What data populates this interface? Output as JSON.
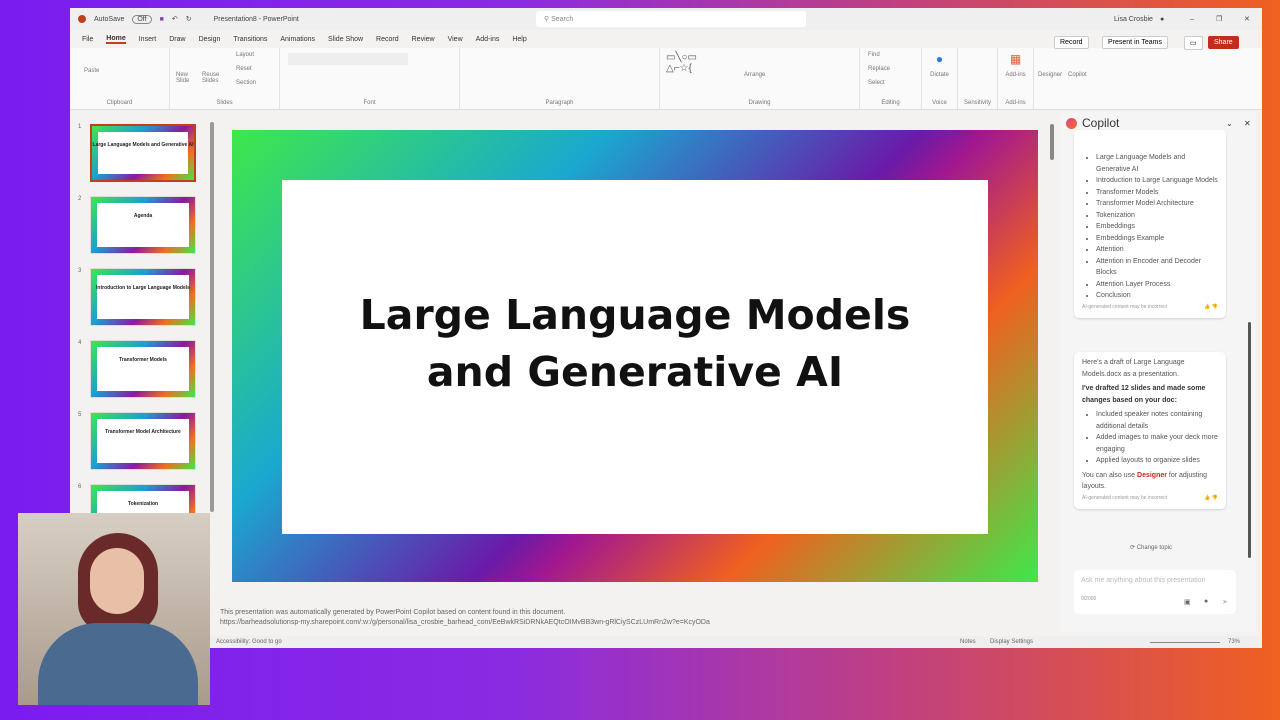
{
  "titlebar": {
    "autosave": "AutoSave",
    "autosave_state": "Off",
    "doc_title": "Presentation8 - PowerPoint",
    "search_placeholder": "Search",
    "user": "Lisa Crosbie"
  },
  "tabs": [
    "File",
    "Home",
    "Insert",
    "Draw",
    "Design",
    "Transitions",
    "Animations",
    "Slide Show",
    "Record",
    "Review",
    "View",
    "Add-ins",
    "Help"
  ],
  "actions": {
    "record": "Record",
    "present": "Present in Teams",
    "share": "Share"
  },
  "ribbon_groups": [
    "Clipboard",
    "Slides",
    "Font",
    "Paragraph",
    "Drawing",
    "Editing",
    "Voice",
    "Sensitivity",
    "Add-ins"
  ],
  "ribbon_buttons": {
    "paste": "Paste",
    "new_slide": "New Slide",
    "reuse": "Reuse Slides",
    "layout": "Layout",
    "reset": "Reset",
    "section": "Section",
    "arrange": "Arrange",
    "find": "Find",
    "replace": "Replace",
    "select": "Select",
    "dictate": "Dictate",
    "addins": "Add-ins",
    "designer": "Designer",
    "copilot": "Copilot"
  },
  "thumbnails": [
    {
      "num": "1",
      "title": "Large Language Models and Generative AI"
    },
    {
      "num": "2",
      "title": "Agenda"
    },
    {
      "num": "3",
      "title": "Introduction to Large Language Models"
    },
    {
      "num": "4",
      "title": "Transformer Models"
    },
    {
      "num": "5",
      "title": "Transformer Model Architecture"
    },
    {
      "num": "6",
      "title": "Tokenization"
    }
  ],
  "slide": {
    "title_line1": "Large Language Models",
    "title_line2": "and Generative AI"
  },
  "notes": {
    "line1": "This presentation was automatically generated by PowerPoint Copilot based on content found in this document.",
    "line2": "https://barheadsolutionsp-my.sharepoint.com/:w:/g/personal/lisa_crosbie_barhead_com/EeBwkRSiDRNkAEQtcOIMvBB3wn-gRlCiySCzLUmRn2w?e=KcyODa"
  },
  "status": {
    "accessibility": "Accessibility: Good to go",
    "notes": "Notes",
    "display": "Display Settings",
    "zoom": "73%"
  },
  "copilot": {
    "title": "Copilot",
    "outline": [
      "Large Language Models and Generative AI",
      "Introduction to Large Language Models",
      "Transformer Models",
      "Transformer Model Architecture",
      "Tokenization",
      "Embeddings",
      "Embeddings Example",
      "Attention",
      "Attention in Encoder and Decoder Blocks",
      "Attention Layer Process",
      "Conclusion"
    ],
    "disclaimer": "AI-generated content may be incorrect",
    "msg_intro": "Here's a draft of Large Language Models.docx as a presentation.",
    "msg_bold": "I've drafted 12 slides and made some changes based on your doc:",
    "changes": [
      "Included speaker notes containing additional details",
      "Added images to make your deck more engaging",
      "Applied layouts to organize slides"
    ],
    "designer_pre": "You can also use ",
    "designer_link": "Designer",
    "designer_post": " for adjusting layouts.",
    "change_topic": "Change topic",
    "ask_placeholder": "Ask me anything about this presentation",
    "counter": "0/2000"
  }
}
